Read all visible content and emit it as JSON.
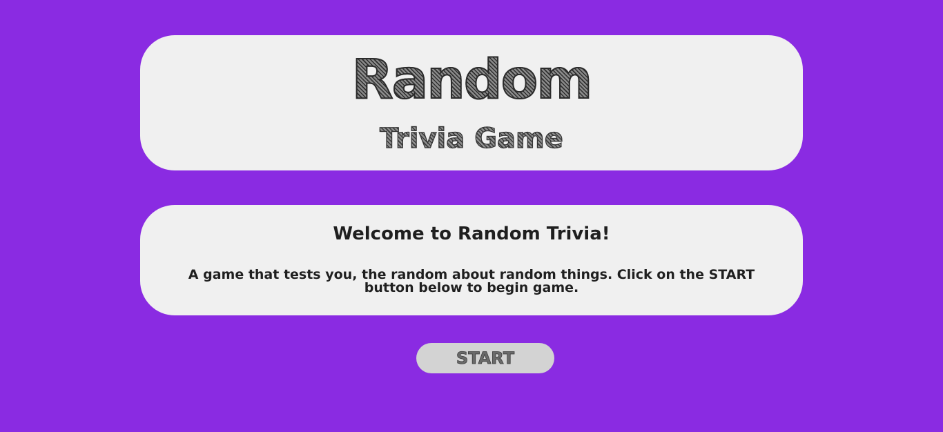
{
  "header": {
    "title": "Random",
    "subtitle": "Trivia Game"
  },
  "intro": {
    "heading": "Welcome to Random Trivia!",
    "description": "A game that tests you, the random about random things. Click on the START button below to begin game."
  },
  "controls": {
    "start_label": "START"
  },
  "colors": {
    "background": "#8a2be2",
    "card": "#f0f0f0",
    "button": "#d3d3d3",
    "text": "#1f1f1f"
  }
}
